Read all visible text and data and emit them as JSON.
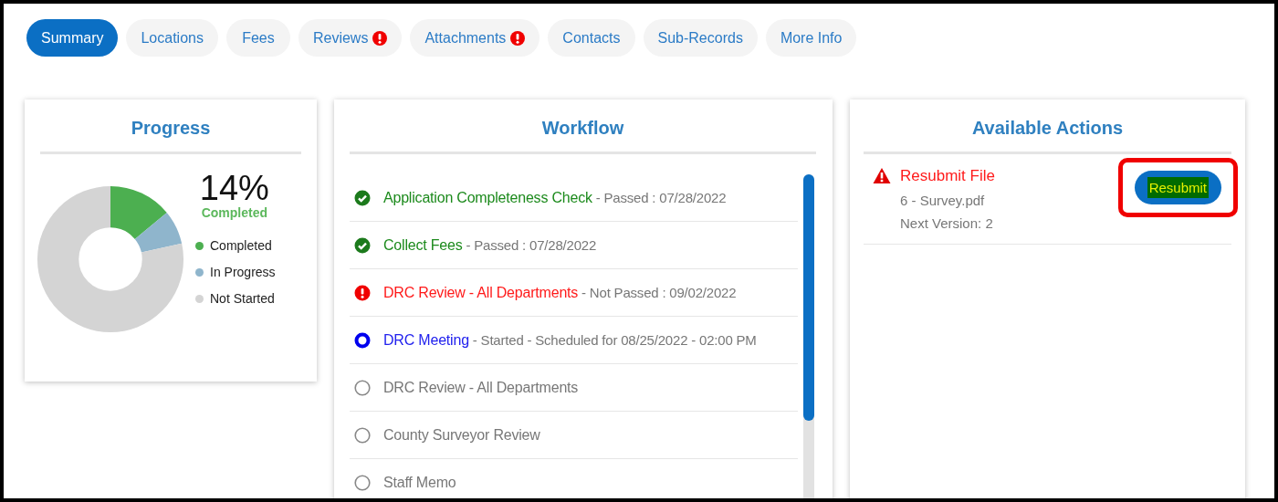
{
  "tabs": [
    {
      "label": "Summary",
      "selected": true,
      "alert": false
    },
    {
      "label": "Locations",
      "selected": false,
      "alert": false
    },
    {
      "label": "Fees",
      "selected": false,
      "alert": false
    },
    {
      "label": "Reviews",
      "selected": false,
      "alert": true
    },
    {
      "label": "Attachments",
      "selected": false,
      "alert": true
    },
    {
      "label": "Contacts",
      "selected": false,
      "alert": false
    },
    {
      "label": "Sub-Records",
      "selected": false,
      "alert": false
    },
    {
      "label": "More Info",
      "selected": false,
      "alert": false
    }
  ],
  "progress": {
    "title": "Progress",
    "percent": "14%",
    "percent_caption": "Completed",
    "legend": [
      {
        "label": "Completed",
        "color": "#4caf50"
      },
      {
        "label": "In Progress",
        "color": "#8fb5cc"
      },
      {
        "label": "Not Started",
        "color": "#d4d4d4"
      }
    ]
  },
  "workflow": {
    "title": "Workflow",
    "steps": [
      {
        "kind": "passed",
        "name": "Application Completeness Check",
        "detail": "- Passed : 07/28/2022"
      },
      {
        "kind": "passed",
        "name": "Collect Fees",
        "detail": "- Passed : 07/28/2022"
      },
      {
        "kind": "failed",
        "name": "DRC Review - All Departments",
        "detail": "- Not Passed : 09/02/2022"
      },
      {
        "kind": "started",
        "name": "DRC Meeting",
        "detail": "- Started - Scheduled for 08/25/2022 - 02:00 PM"
      },
      {
        "kind": "pending",
        "name": "DRC Review - All Departments"
      },
      {
        "kind": "pending",
        "name": "County Surveyor Review"
      },
      {
        "kind": "pending",
        "name": "Staff Memo"
      }
    ]
  },
  "actions": {
    "title": "Available Actions",
    "items": [
      {
        "kind": "warning",
        "title": "Resubmit File",
        "lines": [
          "6 - Survey.pdf",
          "Next Version: 2"
        ],
        "button": "Resubmit",
        "highlighted": true
      }
    ]
  }
}
